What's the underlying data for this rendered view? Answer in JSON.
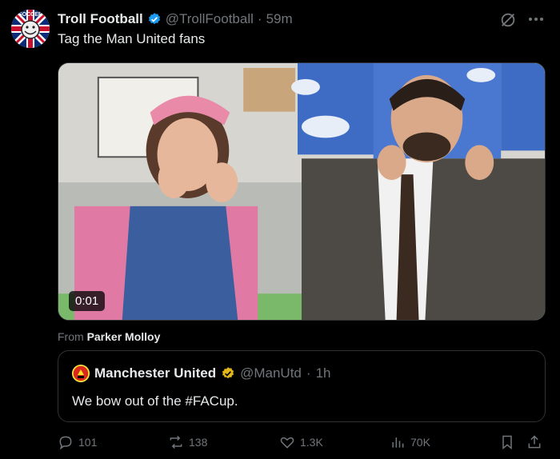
{
  "tweet": {
    "author_name": "Troll Football",
    "handle": "@TrollFootball",
    "separator": "·",
    "time": "59m",
    "text": "Tag the Man United fans",
    "video_time": "0:01",
    "from_label": "From",
    "from_name": "Parker Molloy",
    "avatar_text": "SOCCER"
  },
  "quote": {
    "author_name": "Manchester United",
    "handle": "@ManUtd",
    "separator": "·",
    "time": "1h",
    "text": "We bow out of the #FACup."
  },
  "actions": {
    "replies": "101",
    "reposts": "138",
    "likes": "1.3K",
    "views": "70K"
  },
  "colors": {
    "verified": "#1d9bf0",
    "gold_verified": "#e2b719",
    "muted": "#71767b"
  }
}
